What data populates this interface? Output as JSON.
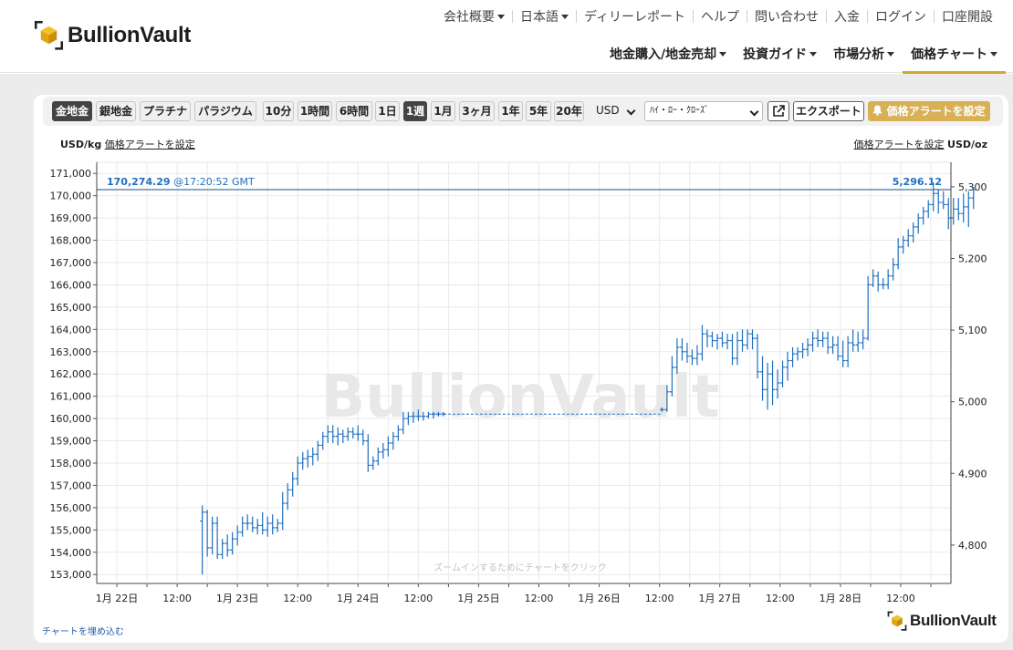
{
  "header": {
    "logo_text": "BullionVault",
    "top_nav": [
      "会社概要",
      "日本語",
      "ディリーレポート",
      "ヘルプ",
      "問い合わせ",
      "入金",
      "ログイン",
      "口座開設"
    ],
    "main_nav": [
      "地金購入/地金売却",
      "投資ガイド",
      "市場分析",
      "価格チャート"
    ]
  },
  "toolbar": {
    "metals": [
      "金地金",
      "銀地金",
      "プラチナ",
      "パラジウム"
    ],
    "periods": [
      "10分",
      "1時間",
      "6時間",
      "1日",
      "1週",
      "1月",
      "3ヶ月",
      "1年",
      "5年",
      "20年"
    ],
    "currency": "USD",
    "chart_style": "ﾊｲ・ﾛｰ・ｸﾛｰｽﾞ",
    "export_label": "エクスポート",
    "alert_label": "価格アラートを設定"
  },
  "labels": {
    "left_unit": "USD/kg",
    "right_unit": "USD/oz",
    "alert_link_left": "価格アラートを設定",
    "alert_link_right": "価格アラートを設定",
    "zoom_hint": "ズームインするためにチャートをクリック",
    "embed_link": "チャートを埋め込む",
    "footer_logo": "BullionVault",
    "watermark": "BullionVault"
  },
  "colors": {
    "accent": "#d3a82e",
    "series": "#1f6fbf",
    "active_button": "#444444",
    "alert_button": "#d8b157"
  },
  "chart_data": {
    "type": "ohlc",
    "title": "",
    "current": {
      "price_kg": "170,274.29",
      "time": "@17:20:52 GMT",
      "price_oz": "5,296.12"
    },
    "left_axis": {
      "unit": "USD/kg",
      "ticks": [
        153000,
        154000,
        155000,
        156000,
        157000,
        158000,
        159000,
        160000,
        161000,
        162000,
        163000,
        164000,
        165000,
        166000,
        167000,
        168000,
        169000,
        170000,
        171000
      ]
    },
    "right_axis": {
      "unit": "USD/oz",
      "ticks": [
        4800,
        4900,
        5000,
        5100,
        5200,
        5300
      ]
    },
    "x_ticks": [
      "1月 22日",
      "12:00",
      "1月 23日",
      "12:00",
      "1月 24日",
      "12:00",
      "1月 25日",
      "12:00",
      "1月 26日",
      "12:00",
      "1月 27日",
      "12:00",
      "1月 28日",
      "12:00"
    ],
    "x_start": "2026-01-21T20:00Z",
    "x_end": "2026-01-28T22:00Z",
    "ylim": [
      152600,
      171500
    ],
    "bars_interval_hours": 1,
    "bars": [
      [
        21.0,
        155400,
        156100,
        153000,
        155800
      ],
      [
        22.0,
        155800,
        155900,
        153800,
        154200
      ],
      [
        23.0,
        154200,
        155600,
        153900,
        155300
      ],
      [
        24.0,
        155300,
        155600,
        153700,
        153900
      ],
      [
        25.0,
        153900,
        154600,
        153700,
        154400
      ],
      [
        26.0,
        154400,
        154800,
        153800,
        154100
      ],
      [
        27.0,
        154100,
        154900,
        153900,
        154600
      ],
      [
        28.0,
        154600,
        155200,
        154300,
        154900
      ],
      [
        29.0,
        154900,
        155600,
        154700,
        155300
      ],
      [
        30.0,
        155300,
        155700,
        155000,
        155300
      ],
      [
        31.0,
        155300,
        155600,
        154900,
        155100
      ],
      [
        32.0,
        155100,
        155500,
        154800,
        155200
      ],
      [
        33.0,
        155200,
        155800,
        154800,
        155000
      ],
      [
        34.0,
        155000,
        155600,
        154700,
        155300
      ],
      [
        35.0,
        155300,
        155700,
        154800,
        155100
      ],
      [
        36.0,
        155100,
        155500,
        154900,
        155300
      ],
      [
        37.0,
        155300,
        156700,
        155000,
        156200
      ],
      [
        38.0,
        156200,
        157100,
        155900,
        156800
      ],
      [
        39.0,
        156800,
        157600,
        156500,
        157300
      ],
      [
        40.0,
        157300,
        158300,
        157000,
        158000
      ],
      [
        41.0,
        158000,
        158500,
        157700,
        158200
      ],
      [
        42.0,
        158200,
        158600,
        157800,
        158300
      ],
      [
        43.0,
        158300,
        158700,
        157900,
        158400
      ],
      [
        44.0,
        158400,
        159000,
        158100,
        158800
      ],
      [
        45.0,
        158800,
        159400,
        158600,
        159200
      ],
      [
        46.0,
        159200,
        159700,
        158900,
        159400
      ],
      [
        47.0,
        159400,
        159700,
        158900,
        159200
      ],
      [
        48.0,
        159200,
        159600,
        158800,
        159300
      ],
      [
        49.0,
        159300,
        159500,
        158900,
        159200
      ],
      [
        50.0,
        159200,
        159600,
        159000,
        159400
      ],
      [
        51.0,
        159400,
        159600,
        159100,
        159300
      ],
      [
        52.0,
        159300,
        159700,
        159000,
        159300
      ],
      [
        53.0,
        159300,
        159500,
        158800,
        159000
      ],
      [
        54.0,
        159000,
        159300,
        157600,
        157900
      ],
      [
        55.0,
        157900,
        158300,
        157700,
        158100
      ],
      [
        56.0,
        158100,
        158700,
        157900,
        158500
      ],
      [
        57.0,
        158500,
        158900,
        158200,
        158600
      ],
      [
        58.0,
        158600,
        159200,
        158300,
        158900
      ],
      [
        59.0,
        158900,
        159400,
        158600,
        159200
      ],
      [
        60.0,
        159200,
        159700,
        159000,
        159500
      ],
      [
        61.0,
        159500,
        160300,
        159300,
        160000
      ],
      [
        62.0,
        160000,
        160300,
        159700,
        160100
      ],
      [
        63.0,
        160100,
        160300,
        159800,
        160100
      ],
      [
        64.0,
        160100,
        160400,
        159900,
        160100
      ],
      [
        65.0,
        160100,
        160300,
        159900,
        160100
      ],
      [
        66.0,
        160100,
        160300,
        160000,
        160200
      ],
      [
        67.0,
        160200,
        160300,
        160000,
        160200
      ],
      [
        68.0,
        160200,
        160300,
        160100,
        160200
      ],
      [
        69.0,
        160200,
        160300,
        160100,
        160200
      ],
      [
        112.5,
        160400,
        160500,
        160300,
        160400
      ],
      [
        113.5,
        160400,
        161500,
        160300,
        161200
      ],
      [
        114.5,
        161200,
        162800,
        161000,
        162300
      ],
      [
        115.5,
        162300,
        163600,
        162000,
        163200
      ],
      [
        116.5,
        163200,
        163600,
        162600,
        163000
      ],
      [
        117.5,
        163000,
        163400,
        162500,
        162800
      ],
      [
        118.5,
        162800,
        163100,
        162400,
        162700
      ],
      [
        119.5,
        162700,
        163300,
        162400,
        162900
      ],
      [
        120.5,
        162900,
        164200,
        162600,
        163800
      ],
      [
        121.5,
        163800,
        164000,
        163200,
        163700
      ],
      [
        122.5,
        163700,
        163900,
        163200,
        163500
      ],
      [
        123.5,
        163500,
        163800,
        163100,
        163600
      ],
      [
        124.5,
        163600,
        163900,
        163200,
        163400
      ],
      [
        125.5,
        163400,
        163800,
        163100,
        163500
      ],
      [
        126.5,
        163500,
        163800,
        162400,
        162700
      ],
      [
        127.5,
        162700,
        163900,
        162400,
        163500
      ],
      [
        128.5,
        163500,
        164000,
        163000,
        163300
      ],
      [
        129.5,
        163300,
        164000,
        163100,
        163800
      ],
      [
        130.5,
        163800,
        164000,
        163100,
        163600
      ],
      [
        131.5,
        163600,
        163800,
        161800,
        162100
      ],
      [
        132.5,
        162100,
        162800,
        160800,
        161300
      ],
      [
        133.5,
        161300,
        162500,
        160400,
        162000
      ],
      [
        134.5,
        162000,
        162600,
        160600,
        161300
      ],
      [
        135.5,
        161300,
        162200,
        160900,
        161600
      ],
      [
        136.5,
        161600,
        162600,
        161400,
        162300
      ],
      [
        137.5,
        162300,
        163000,
        161700,
        162600
      ],
      [
        138.5,
        162600,
        163200,
        162300,
        162900
      ],
      [
        139.5,
        162900,
        163200,
        162600,
        163000
      ],
      [
        140.5,
        163000,
        163400,
        162700,
        163100
      ],
      [
        141.5,
        163100,
        163600,
        162800,
        163300
      ],
      [
        142.5,
        163300,
        163900,
        163000,
        163600
      ],
      [
        143.5,
        163600,
        164000,
        163200,
        163500
      ],
      [
        144.5,
        163500,
        163900,
        163200,
        163600
      ],
      [
        145.5,
        163600,
        163900,
        162900,
        163200
      ],
      [
        146.5,
        163200,
        163700,
        162900,
        163300
      ],
      [
        147.5,
        163300,
        163700,
        162600,
        162800
      ],
      [
        148.5,
        162800,
        163500,
        162300,
        162600
      ],
      [
        149.5,
        162600,
        163700,
        162300,
        163400
      ],
      [
        150.5,
        163400,
        164000,
        163000,
        163300
      ],
      [
        151.5,
        163300,
        163900,
        163000,
        163400
      ],
      [
        152.5,
        163400,
        164000,
        163100,
        163600
      ],
      [
        153.5,
        163600,
        166400,
        163500,
        166000
      ],
      [
        154.5,
        166000,
        166700,
        165900,
        166400
      ],
      [
        155.5,
        166400,
        166600,
        165700,
        166000
      ],
      [
        156.5,
        166000,
        166300,
        165800,
        166000
      ],
      [
        157.5,
        166000,
        166700,
        165800,
        166400
      ],
      [
        158.5,
        166400,
        167200,
        166200,
        166900
      ],
      [
        159.5,
        166900,
        168100,
        166700,
        167700
      ],
      [
        160.5,
        167700,
        168200,
        167400,
        168000
      ],
      [
        161.5,
        168000,
        168500,
        167700,
        168200
      ],
      [
        162.5,
        168200,
        168800,
        167900,
        168600
      ],
      [
        163.5,
        168600,
        169200,
        168300,
        169000
      ],
      [
        164.5,
        169000,
        169500,
        168700,
        169300
      ],
      [
        165.5,
        169300,
        169800,
        169000,
        169600
      ],
      [
        166.5,
        169600,
        170600,
        169300,
        170100
      ],
      [
        167.5,
        170100,
        170300,
        169200,
        169700
      ],
      [
        168.5,
        169700,
        170200,
        169400,
        169600
      ],
      [
        169.5,
        169600,
        169900,
        168500,
        169000
      ],
      [
        170.5,
        169000,
        169900,
        168700,
        169400
      ],
      [
        171.5,
        169400,
        169900,
        168900,
        169200
      ],
      [
        172.5,
        169200,
        170100,
        168800,
        169500
      ],
      [
        173.5,
        169500,
        170200,
        168600,
        169900
      ],
      [
        174.5,
        169900,
        170400,
        169400,
        170274
      ]
    ],
    "gaps": [
      [
        69,
        112.5
      ]
    ]
  }
}
